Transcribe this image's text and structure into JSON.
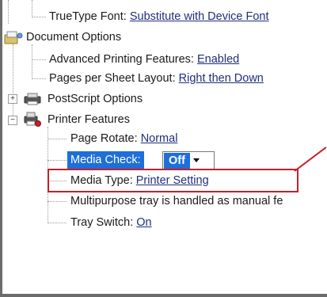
{
  "tree": {
    "truetype_font": {
      "label": "TrueType Font:",
      "value": "Substitute with Device Font"
    },
    "document_options": {
      "label": "Document Options"
    },
    "advanced_printing": {
      "label": "Advanced Printing Features:",
      "value": "Enabled"
    },
    "pages_per_sheet": {
      "label": "Pages per Sheet Layout:",
      "value": "Right then Down"
    },
    "postscript_options": {
      "label": "PostScript Options"
    },
    "printer_features": {
      "label": "Printer Features"
    },
    "page_rotate": {
      "label": "Page Rotate:",
      "value": "Normal"
    },
    "media_check": {
      "label": "Media Check:",
      "value": "Off"
    },
    "media_type": {
      "label": "Media Type:",
      "value": "Printer Setting"
    },
    "multipurpose_tray": {
      "label": "Multipurpose tray is handled as manual fe"
    },
    "tray_switch": {
      "label": "Tray Switch:",
      "value": "On"
    }
  },
  "annotation": {
    "color": "#c4202a"
  },
  "colors": {
    "selection": "#1e6fd9",
    "link_value": "#1f2e7a"
  },
  "icons": {
    "toggle_expanded": "−",
    "toggle_collapsed": "+",
    "document_options_icon": "document-options-icon",
    "postscript_icon": "printer-icon",
    "printer_features_icon": "printer-features-icon",
    "dropdown_arrow": "chevron-down-icon"
  }
}
